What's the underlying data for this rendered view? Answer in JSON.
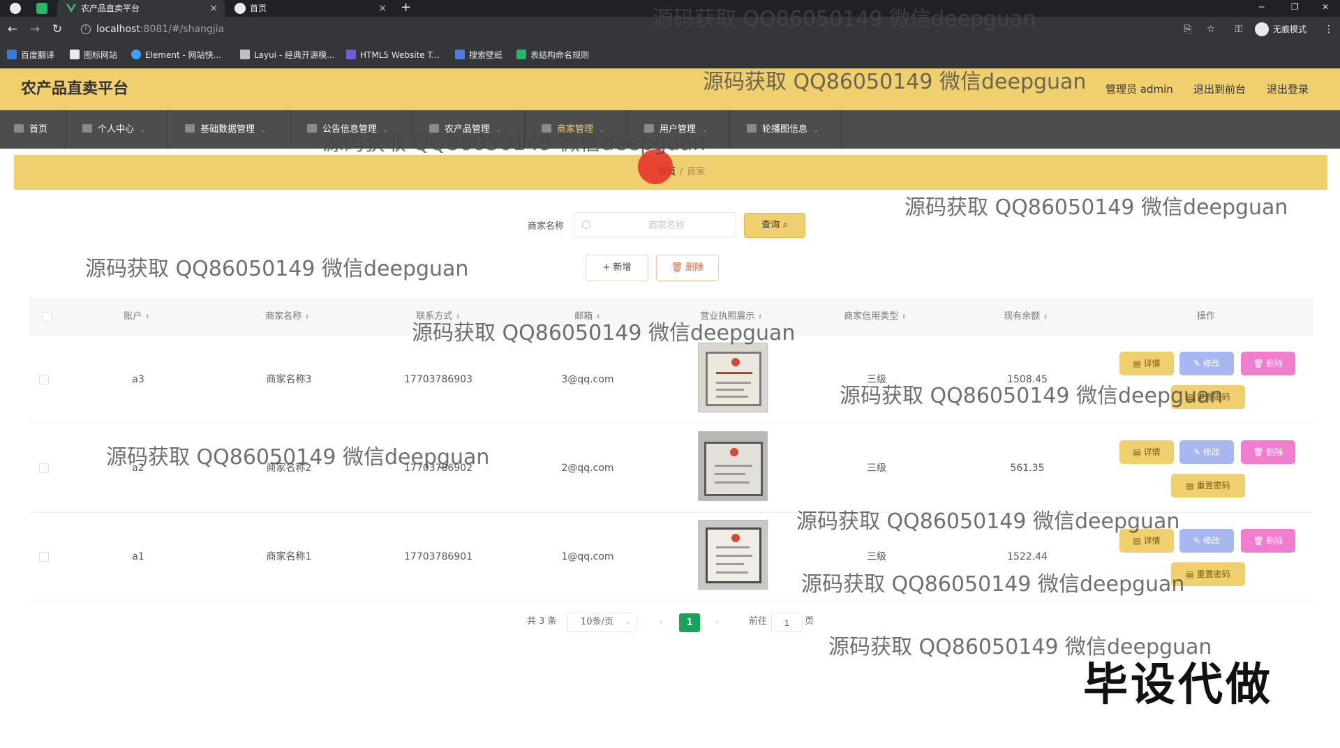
{
  "browser": {
    "tabs": [
      {
        "title": "农产品直卖平台",
        "close": "×"
      },
      {
        "title": "首页",
        "close": "×"
      }
    ],
    "new_tab": "+",
    "window_controls": {
      "minimize": "─",
      "restore": "❐",
      "close": "✕"
    },
    "url_host": "localhost",
    "url_rest": ":8081/#/shangjia",
    "profile_label": "无痕模式",
    "bookmarks": [
      "百度翻译",
      "图标网站",
      "Element - 网站快...",
      "Layui - 经典开源模...",
      "HTML5 Website T...",
      "搜索壁纸",
      "表结构命名规则"
    ]
  },
  "header": {
    "title": "农产品直卖平台",
    "admin_label": "管理员 admin",
    "to_front": "退出到前台",
    "logout": "退出登录"
  },
  "nav": {
    "items": [
      {
        "label": "首页",
        "arrow": ""
      },
      {
        "label": "个人中心",
        "arrow": "⌄"
      },
      {
        "label": "基础数据管理",
        "arrow": "⌄"
      },
      {
        "label": "公告信息管理",
        "arrow": "⌄"
      },
      {
        "label": "农产品管理",
        "arrow": "⌄"
      },
      {
        "label": "商家管理",
        "arrow": "⌄"
      },
      {
        "label": "用户管理",
        "arrow": "⌄"
      },
      {
        "label": "轮播图信息",
        "arrow": "⌄"
      }
    ]
  },
  "breadcrumb": {
    "home": "首页",
    "separator": "/",
    "current": "商家"
  },
  "search": {
    "label": "商家名称",
    "placeholder": "商家名称",
    "button": "查询"
  },
  "actions": {
    "add": "+ 新增",
    "delete": "🗑 删除"
  },
  "table": {
    "columns": [
      "账户",
      "商家名称",
      "联系方式",
      "邮箱",
      "营业执照展示",
      "商家信用类型",
      "现有余额",
      "操作"
    ],
    "sort_glyph": "⬍",
    "rows": [
      {
        "account": "a3",
        "name": "商家名称3",
        "phone": "17703786903",
        "email": "3@qq.com",
        "credit": "三级",
        "balance": "1508.45"
      },
      {
        "account": "a2",
        "name": "商家名称2",
        "phone": "17703786902",
        "email": "2@qq.com",
        "credit": "三级",
        "balance": "561.35"
      },
      {
        "account": "a1",
        "name": "商家名称1",
        "phone": "17703786901",
        "email": "1@qq.com",
        "credit": "三级",
        "balance": "1522.44"
      }
    ],
    "row_buttons": {
      "detail": "详情",
      "edit": "修改",
      "delete": "删除",
      "reset": "重置密码"
    }
  },
  "pagination": {
    "total": "共 3 条",
    "page_size": "10条/页",
    "prev": "‹",
    "current": "1",
    "next": "›",
    "goto_label": "前往",
    "goto_value": "1",
    "unit": "页"
  },
  "watermarks": [
    "源码获取 QQ86050149 微信deepguan",
    "源码获取 QQ86050149 微信deepguan",
    "源码获取 QQ86050149 微信deepguan",
    "源码获取 QQ86050149 微信deepguan",
    "源码获取 QQ86050149 微信deepguan",
    "源码获取 QQ86050149 微信deepguan",
    "源码获取 QQ86050149 微信deepguan",
    "源码获取 QQ86050149 微信deepguan",
    "源码获取 QQ86050149 微信deepguan",
    "源码获取 QQ86050149 微信deepguan",
    "源码获取 QQ86050149 微信deepguan"
  ],
  "overlay_banner": "毕设代做",
  "colors": {
    "accent": "#f0cf6f",
    "nav_bg": "#4d4d4d",
    "page_active": "#19a35a",
    "delete_pink": "#f07dce",
    "edit_blue": "#a9b7f0"
  }
}
